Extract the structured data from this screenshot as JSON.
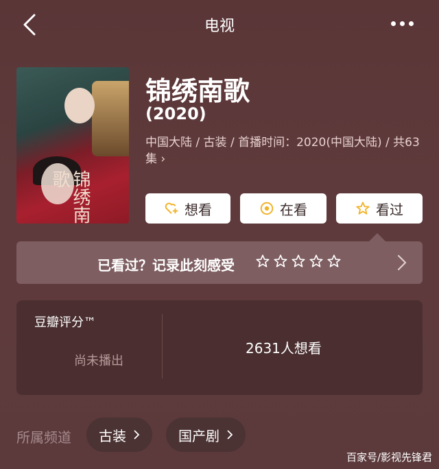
{
  "nav": {
    "title": "电视"
  },
  "show": {
    "name": "锦绣南歌",
    "year": "(2020)",
    "meta": "中国大陆 / 古装 / 首播时间：2020(中国大陆) / 共63集 ›",
    "poster_title": "锦绣南歌"
  },
  "actions": [
    {
      "label": "想看",
      "icon": "heart-plus-icon"
    },
    {
      "label": "在看",
      "icon": "eye-circle-icon"
    },
    {
      "label": "看过",
      "icon": "star-icon"
    }
  ],
  "record": {
    "label": "已看过？记录此刻感受",
    "star_count": 5
  },
  "rating": {
    "label": "豆瓣评分™",
    "status": "尚未播出",
    "want_count": "2631人想看"
  },
  "channels": {
    "label": "所属频道",
    "items": [
      "古装",
      "国产剧"
    ]
  },
  "watermark": "百家号/影视先锋君",
  "colors": {
    "accent": "#f2b32a",
    "background": "#5c3a3c",
    "panel": "#4b2f30",
    "record_bar": "#7e5e61"
  }
}
